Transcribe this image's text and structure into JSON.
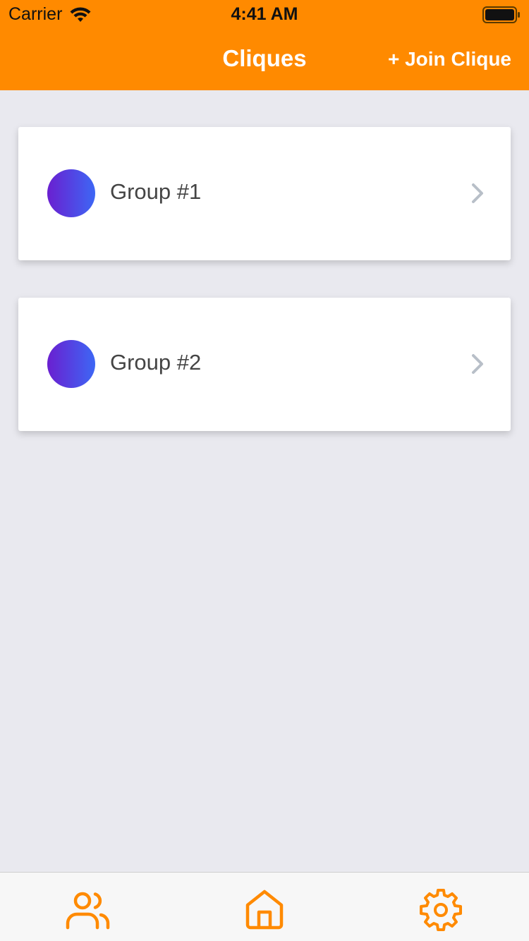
{
  "status_bar": {
    "carrier": "Carrier",
    "time": "4:41 AM",
    "icons": [
      "wifi-icon",
      "battery-icon"
    ]
  },
  "nav": {
    "title": "Cliques",
    "join_label": "+ Join Clique"
  },
  "groups": [
    {
      "name": "Group #1"
    },
    {
      "name": "Group #2"
    }
  ],
  "tab_bar": {
    "tabs": [
      {
        "icon": "users-icon"
      },
      {
        "icon": "home-icon"
      },
      {
        "icon": "gear-icon"
      }
    ]
  },
  "colors": {
    "accent": "#FF8A00",
    "background": "#E9E9EF",
    "avatar_gradient_start": "#6A1FD0",
    "avatar_gradient_end": "#3D67F5",
    "chevron": "#B8BFC8",
    "text": "#444444"
  }
}
